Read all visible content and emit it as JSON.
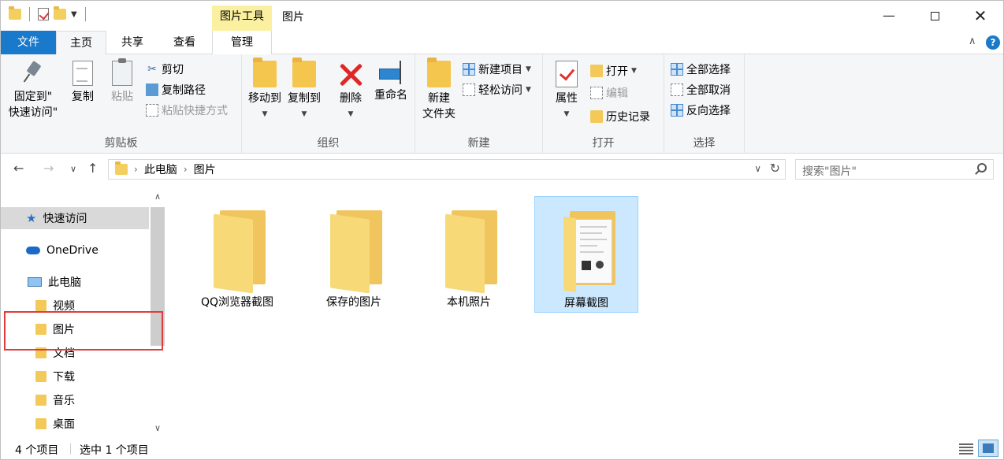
{
  "titlebar": {
    "picture_tools": "图片工具",
    "title": "图片",
    "min_symbol": "—",
    "close_symbol": "✕"
  },
  "tabs": {
    "file": "文件",
    "home": "主页",
    "share": "共享",
    "view": "查看",
    "manage": "管理",
    "help": "?"
  },
  "ribbon": {
    "clipboard": {
      "label": "剪贴板",
      "pin": "固定到\"\n快速访问\"",
      "pin_line1": "固定到\"",
      "pin_line2": "快速访问\"",
      "copy": "复制",
      "paste": "粘贴",
      "cut": "剪切",
      "copy_path": "复制路径",
      "paste_shortcut": "粘贴快捷方式"
    },
    "organize": {
      "label": "组织",
      "move_to": "移动到",
      "copy_to": "复制到",
      "delete": "删除",
      "rename": "重命名"
    },
    "new": {
      "label": "新建",
      "new_folder_line1": "新建",
      "new_folder_line2": "文件夹",
      "new_item": "新建项目",
      "easy_access": "轻松访问"
    },
    "open": {
      "label": "打开",
      "properties": "属性",
      "open": "打开",
      "edit": "编辑",
      "history": "历史记录"
    },
    "select": {
      "label": "选择",
      "select_all": "全部选择",
      "select_none": "全部取消",
      "invert": "反向选择"
    }
  },
  "address": {
    "crumbs": [
      "此电脑",
      "图片"
    ],
    "search_placeholder": "搜索\"图片\""
  },
  "sidebar": {
    "quick_access": "快速访问",
    "onedrive": "OneDrive",
    "this_pc": "此电脑",
    "items": [
      "视频",
      "图片",
      "文档",
      "下载",
      "音乐",
      "桌面"
    ]
  },
  "content": {
    "folders": [
      "QQ浏览器截图",
      "保存的图片",
      "本机照片",
      "屏幕截图"
    ],
    "selected_index": 3
  },
  "status": {
    "count": "4 个项目",
    "selection": "选中 1 个项目"
  },
  "colors": {
    "accent": "#1979ca",
    "selection": "#cce8ff",
    "highlight_box": "#e23b3b",
    "tools_tab": "#fbf0a0"
  }
}
